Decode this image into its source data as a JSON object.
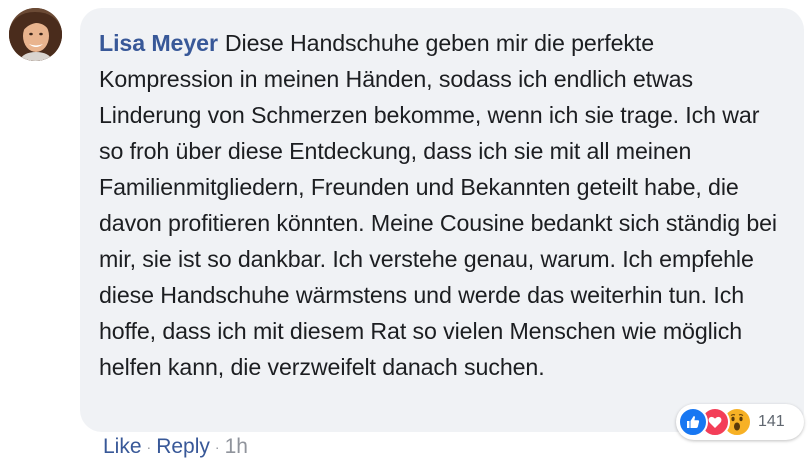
{
  "comment": {
    "author": "Lisa Meyer",
    "text": "Diese Handschuhe geben mir die perfekte Kompression in meinen Händen, sodass ich endlich etwas Linderung von Schmerzen bekomme, wenn ich sie trage. Ich war so froh über diese Entdeckung, dass ich sie mit all meinen Familienmitgliedern, Freunden und Bekannten geteilt habe, die davon profitieren könnten. Meine Cousine bedankt sich ständig bei mir, sie ist so dankbar. Ich verstehe genau, warum. Ich empfehle diese Handschuhe wärmstens und werde das weiterhin tun. Ich hoffe, dass ich mit diesem Rat so vielen Menschen wie möglich helfen kann, die verzweifelt danach suchen."
  },
  "reactions": {
    "icons": [
      "like-icon",
      "love-icon",
      "wow-icon"
    ],
    "count": "141"
  },
  "actions": {
    "like_label": "Like",
    "reply_label": "Reply",
    "separator": "·",
    "time": "1h"
  },
  "colors": {
    "bubble_bg": "#f0f2f5",
    "author": "#385898",
    "link": "#385898",
    "text": "#1c1e21",
    "meta": "#90949c",
    "like": "#1877f2",
    "love": "#f33e58",
    "wow": "#f7b125"
  }
}
